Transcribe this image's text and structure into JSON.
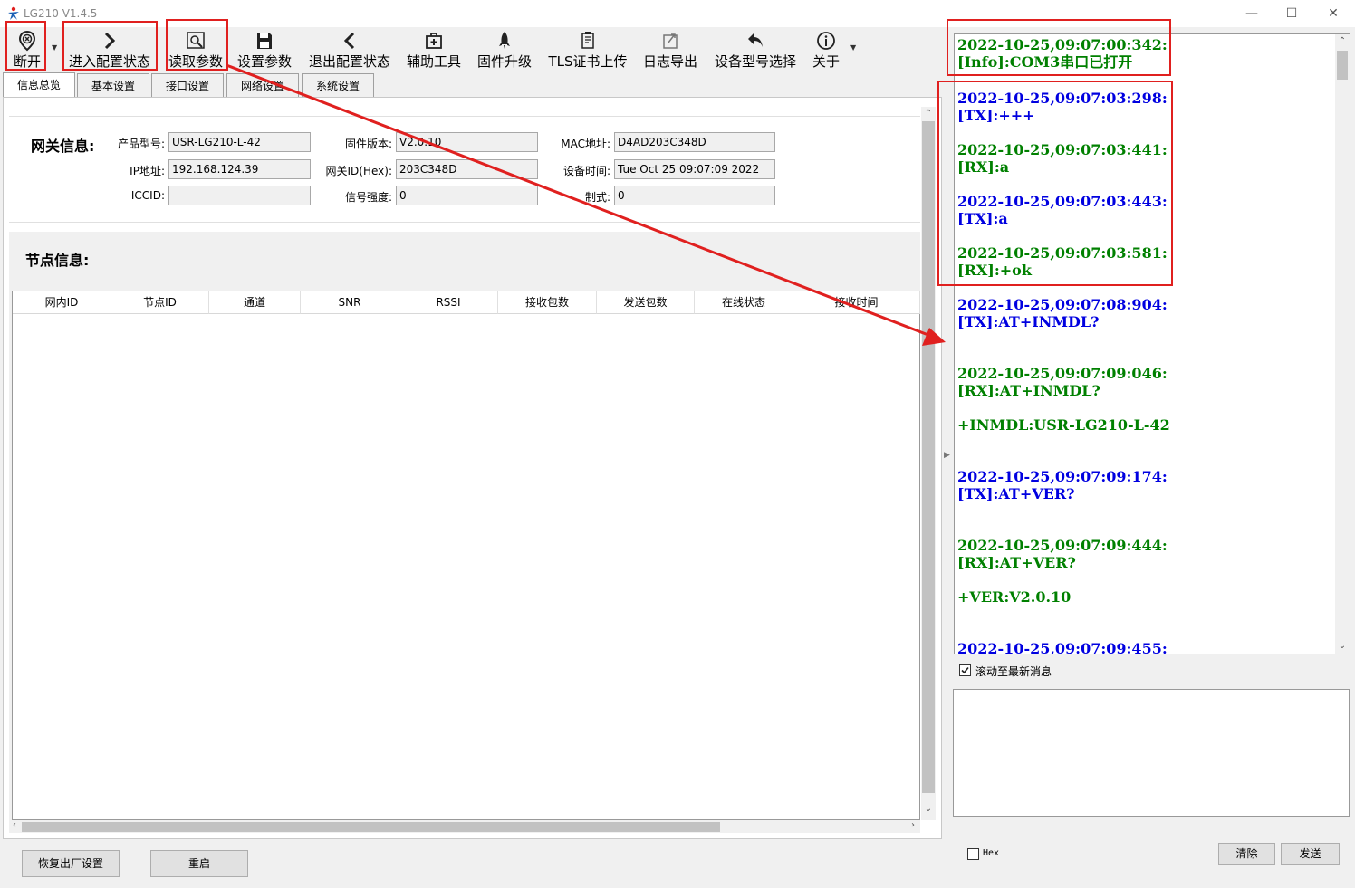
{
  "window": {
    "title": "LG210 V1.4.5",
    "min_glyph": "—",
    "max_glyph": "☐",
    "close_glyph": "✕"
  },
  "toolbar": {
    "items": [
      {
        "label": "断开",
        "icon": "disconnect-icon"
      },
      {
        "label": "进入配置状态",
        "icon": "chevron-right-icon"
      },
      {
        "label": "读取参数",
        "icon": "read-params-icon"
      },
      {
        "label": "设置参数",
        "icon": "save-icon"
      },
      {
        "label": "退出配置状态",
        "icon": "chevron-left-icon"
      },
      {
        "label": "辅助工具",
        "icon": "toolbox-icon"
      },
      {
        "label": "固件升级",
        "icon": "rocket-icon"
      },
      {
        "label": "TLS证书上传",
        "icon": "certificate-icon"
      },
      {
        "label": "日志导出",
        "icon": "export-icon"
      },
      {
        "label": "设备型号选择",
        "icon": "undo-icon"
      },
      {
        "label": "关于",
        "icon": "info-icon"
      }
    ]
  },
  "tabs": [
    "信息总览",
    "基本设置",
    "接口设置",
    "网络设置",
    "系统设置"
  ],
  "gateway": {
    "title": "网关信息:",
    "product_model_label": "产品型号:",
    "product_model": "USR-LG210-L-42",
    "firmware_label": "固件版本:",
    "firmware": "V2.0.10",
    "mac_label": "MAC地址:",
    "mac": "D4AD203C348D",
    "ip_label": "IP地址:",
    "ip": "192.168.124.39",
    "gwid_label": "网关ID(Hex):",
    "gwid": "203C348D",
    "time_label": "设备时间:",
    "time": "Tue Oct 25 09:07:09 2022",
    "iccid_label": "ICCID:",
    "iccid": "",
    "signal_label": "信号强度:",
    "signal": "0",
    "mode_label": "制式:",
    "mode": "0"
  },
  "nodes": {
    "title": "节点信息:",
    "columns": [
      "网内ID",
      "节点ID",
      "通道",
      "SNR",
      "RSSI",
      "接收包数",
      "发送包数",
      "在线状态",
      "接收时间"
    ],
    "rows": []
  },
  "buttons": {
    "factory_reset": "恢复出厂设置",
    "restart": "重启",
    "clear": "清除",
    "send": "发送"
  },
  "log": {
    "lines": [
      {
        "text": "2022-10-25,09:07:00:342:",
        "kind": "rx"
      },
      {
        "text": "[Info]:COM3串口已打开",
        "kind": "rx"
      },
      {
        "text": "2022-10-25,09:07:03:298:",
        "kind": "tx"
      },
      {
        "text": "[TX]:+++",
        "kind": "tx"
      },
      {
        "text": "2022-10-25,09:07:03:441:",
        "kind": "rx"
      },
      {
        "text": "[RX]:a",
        "kind": "rx"
      },
      {
        "text": "2022-10-25,09:07:03:443:",
        "kind": "tx"
      },
      {
        "text": "[TX]:a",
        "kind": "tx"
      },
      {
        "text": "2022-10-25,09:07:03:581:",
        "kind": "rx"
      },
      {
        "text": "[RX]:+ok",
        "kind": "rx"
      },
      {
        "text": "2022-10-25,09:07:08:904:",
        "kind": "tx"
      },
      {
        "text": "[TX]:AT+INMDL?",
        "kind": "tx"
      },
      {
        "text": "2022-10-25,09:07:09:046:",
        "kind": "rx"
      },
      {
        "text": "[RX]:AT+INMDL?",
        "kind": "rx"
      },
      {
        "text": "+INMDL:USR-LG210-L-42",
        "kind": "rx"
      },
      {
        "text": "2022-10-25,09:07:09:174:",
        "kind": "tx"
      },
      {
        "text": "[TX]:AT+VER?",
        "kind": "tx"
      },
      {
        "text": "2022-10-25,09:07:09:444:",
        "kind": "rx"
      },
      {
        "text": "[RX]:AT+VER?",
        "kind": "rx"
      },
      {
        "text": "+VER:V2.0.10",
        "kind": "rx"
      },
      {
        "text": "2022-10-25,09:07:09:455:",
        "kind": "tx"
      }
    ],
    "autoscroll_label": "滚动至最新消息",
    "autoscroll_checked": true,
    "hex_label": "Hex",
    "hex_checked": false
  },
  "colors": {
    "rx": "#008000",
    "tx": "#0000e0",
    "annotation": "#e0201f"
  }
}
